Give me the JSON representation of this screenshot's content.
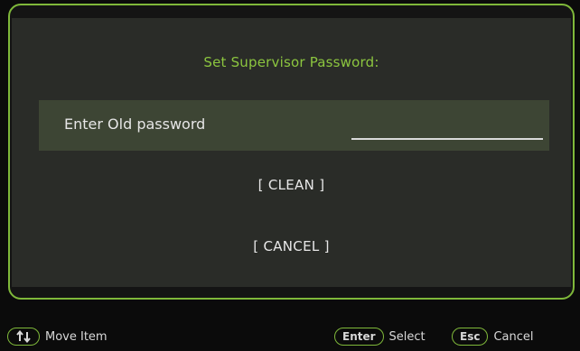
{
  "dialog": {
    "title": "Set Supervisor Password:",
    "field_label": "Enter Old password",
    "field_value": "",
    "options": {
      "clean": "[ CLEAN ]",
      "cancel": "[ CANCEL ]"
    }
  },
  "footer": {
    "move": {
      "key_icon": "up-down-arrows-icon",
      "label": "Move Item"
    },
    "select": {
      "key": "Enter",
      "label": "Select"
    },
    "cancel": {
      "key": "Esc",
      "label": "Cancel"
    }
  },
  "colors": {
    "accent": "#8cc63f",
    "background": "#0b0b0b",
    "panel": "#2a2c28",
    "highlight_row": "#3d4534",
    "text": "#e6e6e6"
  }
}
